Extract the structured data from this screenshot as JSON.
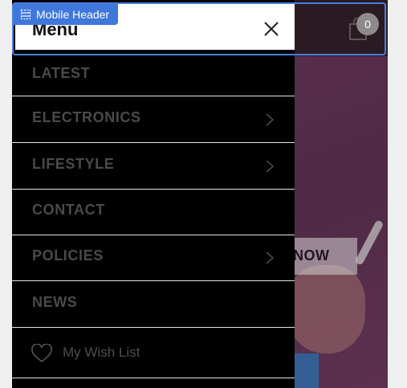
{
  "header": {
    "cart_count": "0"
  },
  "hero": {
    "cta_label": "NOW"
  },
  "drawer": {
    "title": "Menu",
    "items": [
      {
        "label": "LATEST",
        "has_submenu": false
      },
      {
        "label": "ELECTRONICS",
        "has_submenu": true
      },
      {
        "label": "LIFESTYLE",
        "has_submenu": true
      },
      {
        "label": "CONTACT",
        "has_submenu": false
      },
      {
        "label": "POLICIES",
        "has_submenu": true
      },
      {
        "label": "NEWS",
        "has_submenu": false
      }
    ],
    "wish_list_label": "My Wish List"
  },
  "editor": {
    "selection_label": "Mobile Header"
  },
  "icons": {
    "close": "close-icon",
    "chevron": "chevron-right-icon",
    "heart": "heart-icon",
    "cart": "shopping-bag-icon",
    "section": "section-icon"
  },
  "colors": {
    "drawer_bg": "#000000",
    "selection": "#3f77db",
    "hero_bg": "#4f2a45"
  }
}
